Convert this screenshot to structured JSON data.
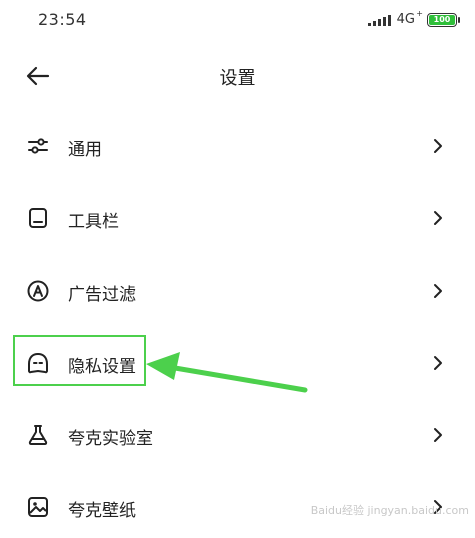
{
  "status": {
    "time": "23:54",
    "network": "4G",
    "network_sup": "+",
    "battery": "100",
    "battery_level": 1.0
  },
  "header": {
    "title": "设置"
  },
  "items": [
    {
      "label": "通用",
      "icon": "sliders-icon"
    },
    {
      "label": "工具栏",
      "icon": "toolbar-icon"
    },
    {
      "label": "广告过滤",
      "icon": "ad-filter-icon"
    },
    {
      "label": "隐私设置",
      "icon": "privacy-mask-icon"
    },
    {
      "label": "夸克实验室",
      "icon": "flask-icon"
    },
    {
      "label": "夸克壁纸",
      "icon": "image-icon"
    }
  ],
  "colors": {
    "highlight": "#4cd04c",
    "battery": "#2fbf3a",
    "text": "#222222"
  },
  "watermark": "Baidu经验 jingyan.baidu.com"
}
